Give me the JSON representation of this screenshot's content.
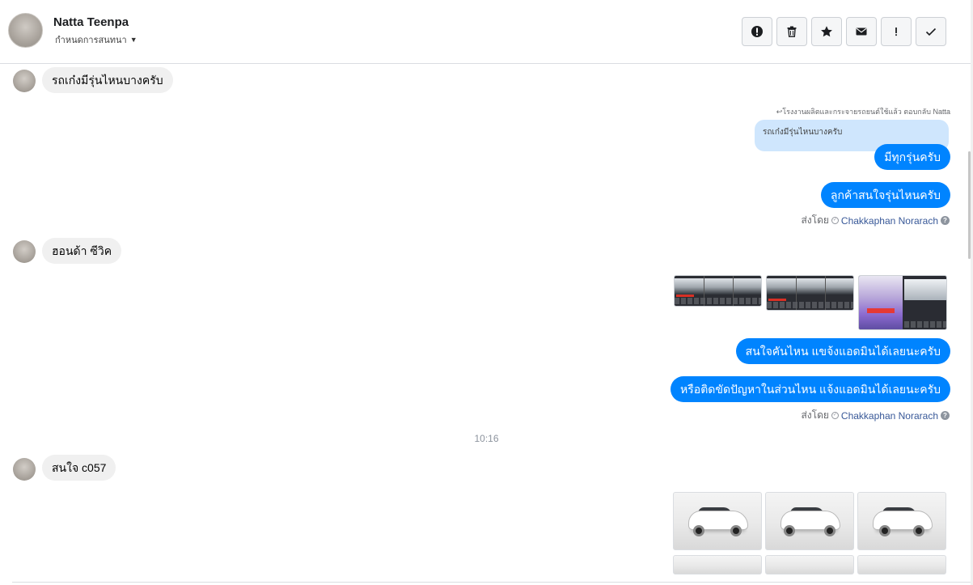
{
  "header": {
    "name": "Natta Teenpa",
    "status": "กำหนดการสนทนา",
    "toolbar": [
      {
        "name": "alert-icon",
        "label": "report"
      },
      {
        "name": "trash-icon",
        "label": "delete"
      },
      {
        "name": "star-icon",
        "label": "star"
      },
      {
        "name": "mail-icon",
        "label": "mark unread"
      },
      {
        "name": "exclamation-icon",
        "label": "spam"
      },
      {
        "name": "check-icon",
        "label": "done"
      }
    ]
  },
  "messages": {
    "in1": "รถเก๋งมีรุ่นไหนบางครับ",
    "reply_note": "↩โรงงานผลิตและกระจายรถยนต์ใช้แล้ว ตอบกลับ Natta",
    "reply_quote": "รถเก๋งมีรุ่นไหนบางครับ",
    "out1": "มีทุกรุ่นครับ",
    "out2": "ลูกค้าสนใจรุ่นไหนครับ",
    "sent_by_label": "ส่งโดย",
    "sent_by_name": "Chakkaphan Norarach",
    "in2": "ฮอนด้า ซีวิค",
    "out3": "สนใจคันไหน แขจ้งแอดมินได้เลยนะครับ",
    "out4": "หรือติดขัดปัญหาในส่วนไหน แจ้งแอดมินได้เลยนะครับ",
    "timestamp": "10:16",
    "in3": "สนใจ c057"
  },
  "colors": {
    "accent": "#0084ff",
    "incoming_bubble": "#f0f0f0",
    "quote_bg": "#cfe6fd"
  }
}
